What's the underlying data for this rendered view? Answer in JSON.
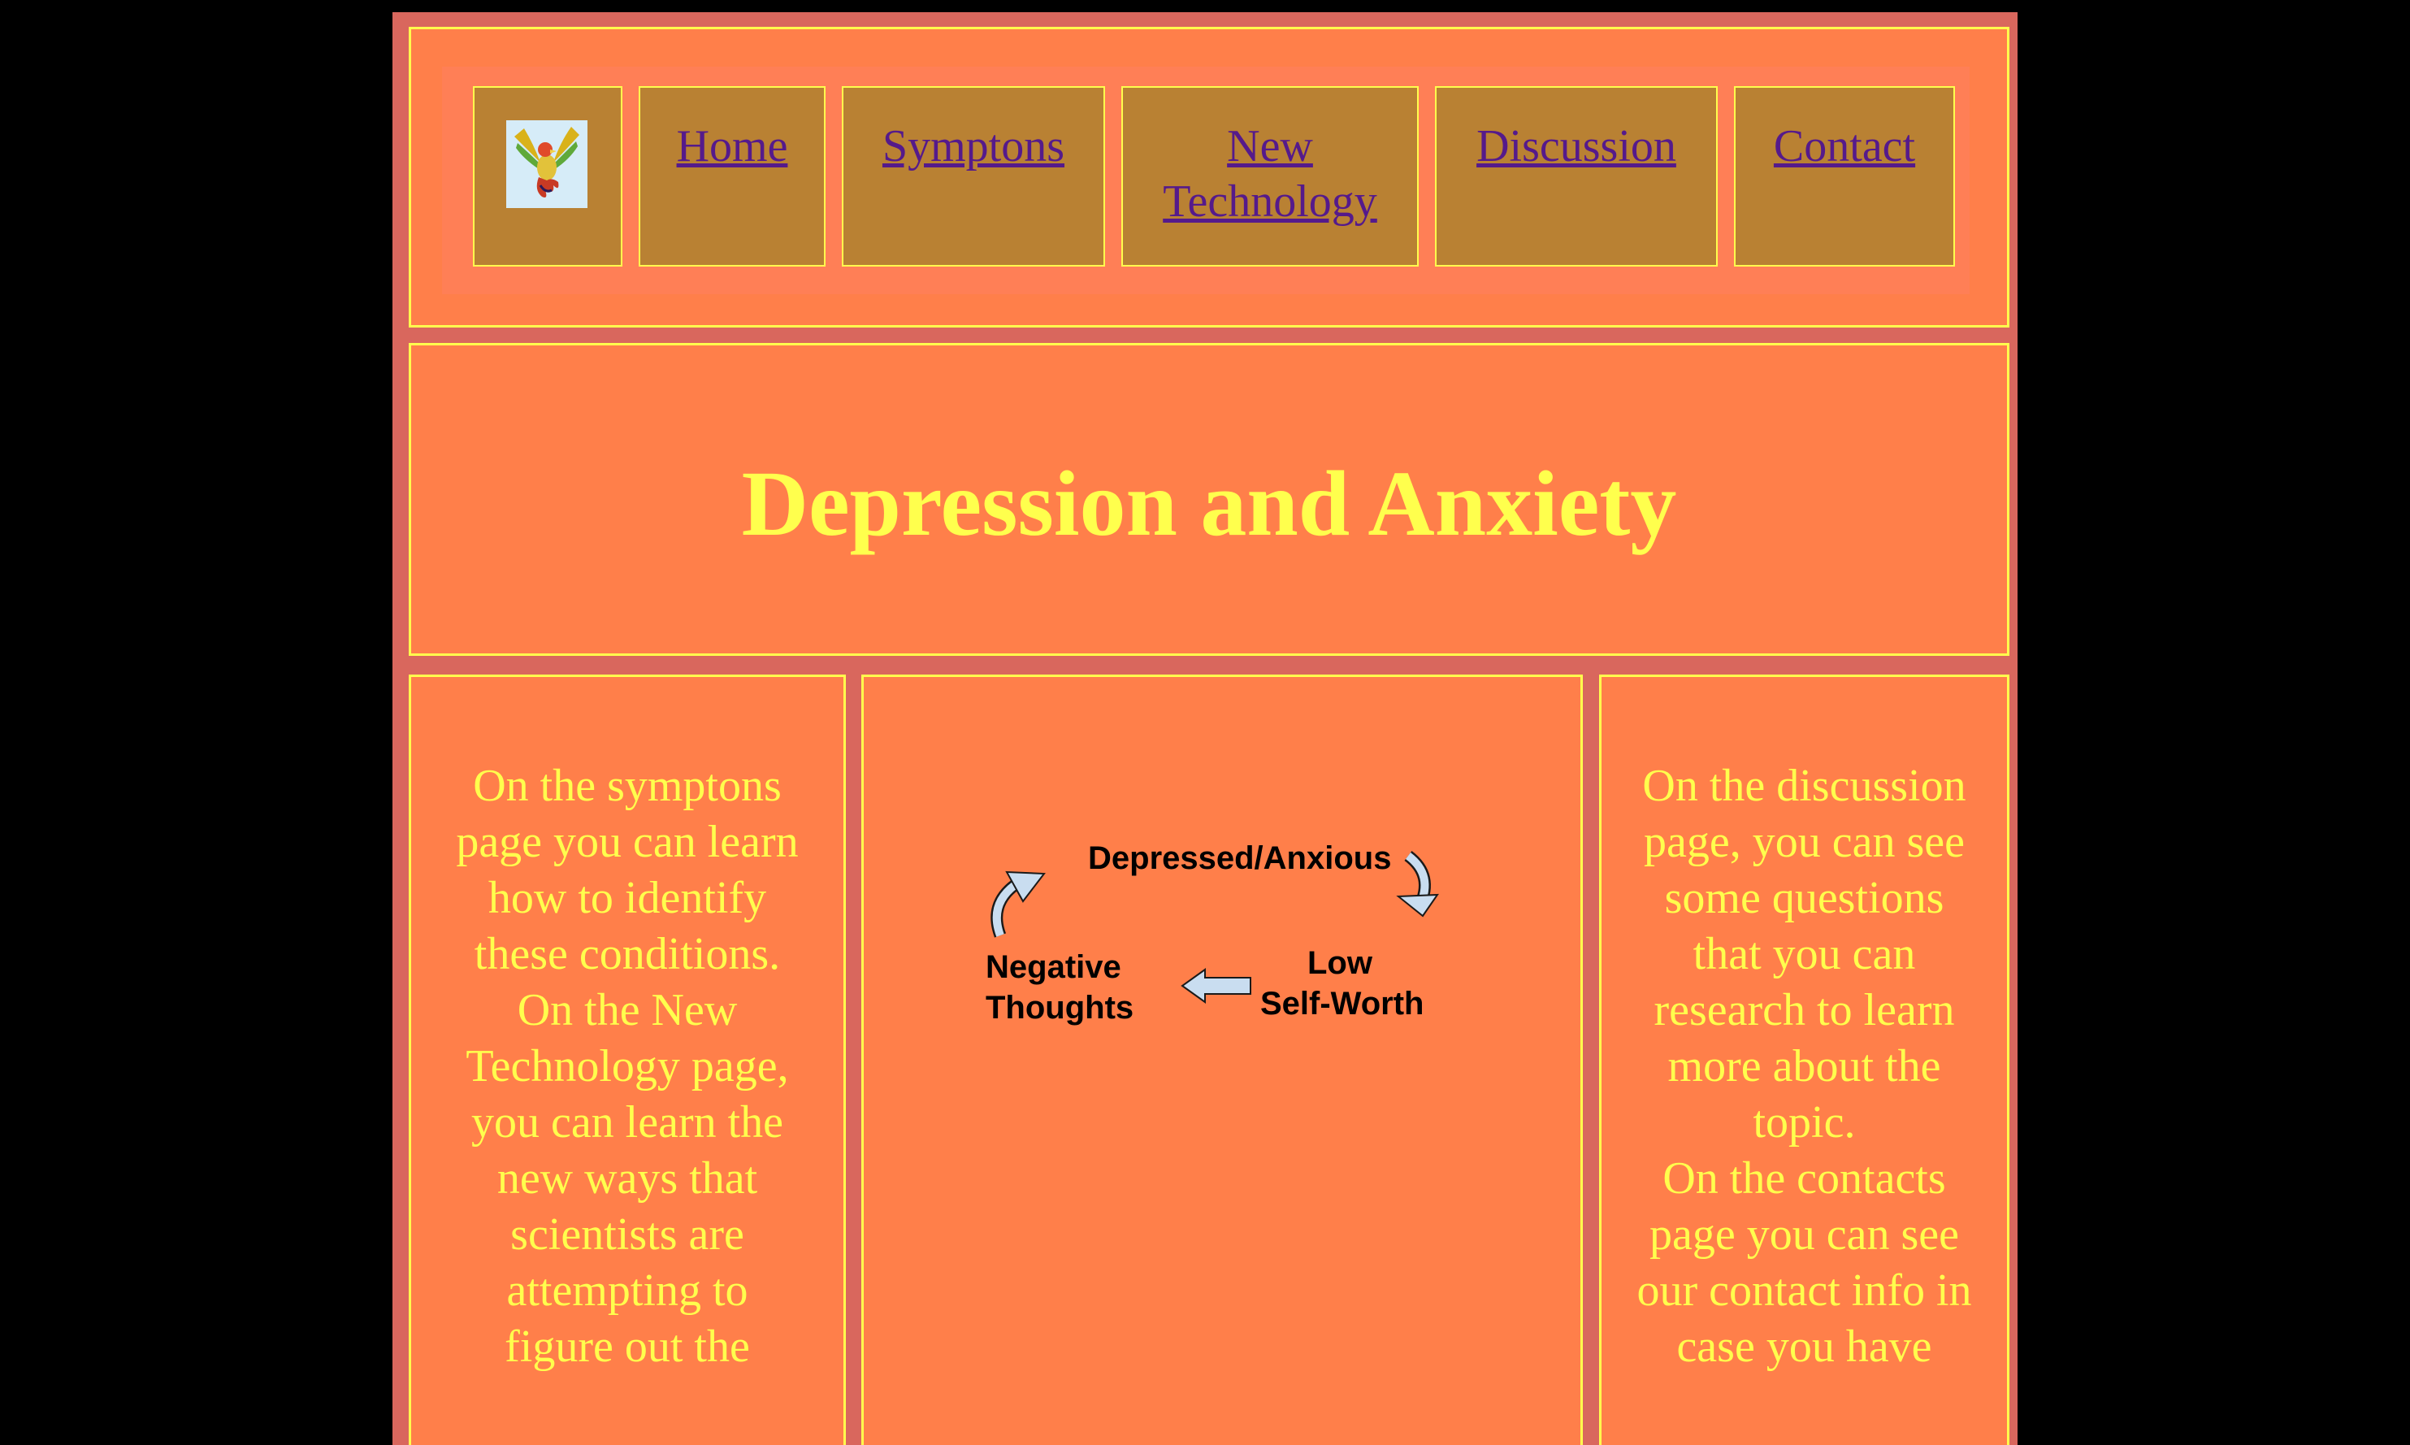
{
  "nav": {
    "links": [
      {
        "label": "Home"
      },
      {
        "label": "Symptons"
      },
      {
        "label": "New Technology"
      },
      {
        "label": "Discussion"
      },
      {
        "label": "Contact"
      }
    ],
    "logo_icon": "phoenix-logo-icon"
  },
  "header": {
    "title": "Depression and Anxiety"
  },
  "left_column": {
    "paragraph1": "On the symptons page you can learn how to identify these conditions.",
    "paragraph2": "On the New Technology page, you can learn the new ways that scientists are attempting to figure out the"
  },
  "diagram": {
    "node_top": "Depressed/Anxious",
    "node_right_line1": "Low",
    "node_right_line2": "Self-Worth",
    "node_left_line1": "Negative",
    "node_left_line2": "Thoughts"
  },
  "right_column": {
    "paragraph1": "On the discussion page, you can see some questions that you can research to learn more about the topic.",
    "paragraph2": "On the contacts page you can see our contact info in case you have"
  },
  "colors": {
    "page_background": "#000000",
    "container": "#d9675d",
    "box": "#ff7f4a",
    "border": "#ffff4d",
    "nav_cell": "#b98133",
    "link": "#551a8b",
    "heading": "#ffff4d"
  }
}
